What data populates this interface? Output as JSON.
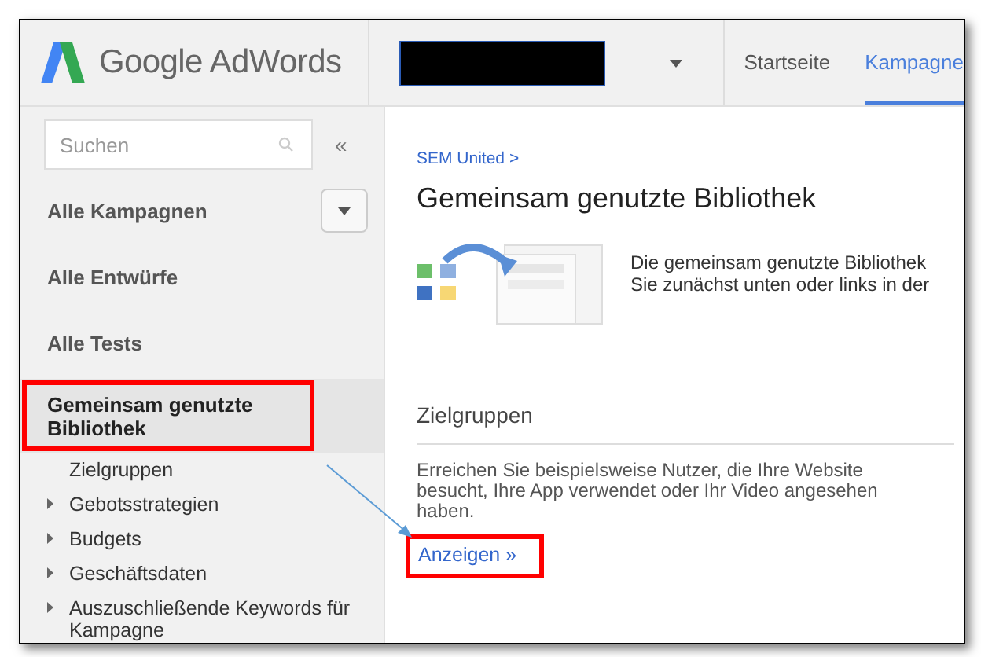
{
  "header": {
    "product": "Google AdWords",
    "account_redacted": true,
    "nav": [
      {
        "label": "Startseite",
        "selected": false
      },
      {
        "label": "Kampagne",
        "selected": true
      }
    ]
  },
  "sidebar": {
    "search": {
      "placeholder": "Suchen"
    },
    "collapse": "«",
    "items": [
      {
        "label": "Alle Kampagnen",
        "kind": "dropdown",
        "selected": false,
        "highlighted": false
      },
      {
        "label": "Alle Entwürfe",
        "kind": "plain",
        "selected": false,
        "highlighted": false
      },
      {
        "label": "Alle Tests",
        "kind": "plain",
        "selected": false,
        "highlighted": false
      },
      {
        "label": "Gemeinsam genutzte Bibliothek",
        "kind": "plain",
        "selected": true,
        "highlighted": true,
        "children": [
          {
            "label": "Zielgruppen",
            "kind": "leaf"
          },
          {
            "label": "Gebotsstrategien",
            "kind": "folder"
          },
          {
            "label": "Budgets",
            "kind": "folder"
          },
          {
            "label": "Geschäftsdaten",
            "kind": "folder"
          },
          {
            "label": "Auszuschließende Keywords für Kampagne",
            "kind": "folder"
          }
        ]
      }
    ]
  },
  "content": {
    "breadcrumb": "SEM United >",
    "title": "Gemeinsam genutzte Bibliothek",
    "intro": [
      "Die gemeinsam genutzte Bibliothek",
      "Sie zunächst unten oder links in der"
    ],
    "section": {
      "heading": "Zielgruppen",
      "text": "Erreichen Sie beispielsweise Nutzer, die Ihre Website besucht, Ihre App verwendet oder Ihr Video angesehen haben.",
      "link": "Anzeigen »",
      "highlighted": true
    }
  }
}
